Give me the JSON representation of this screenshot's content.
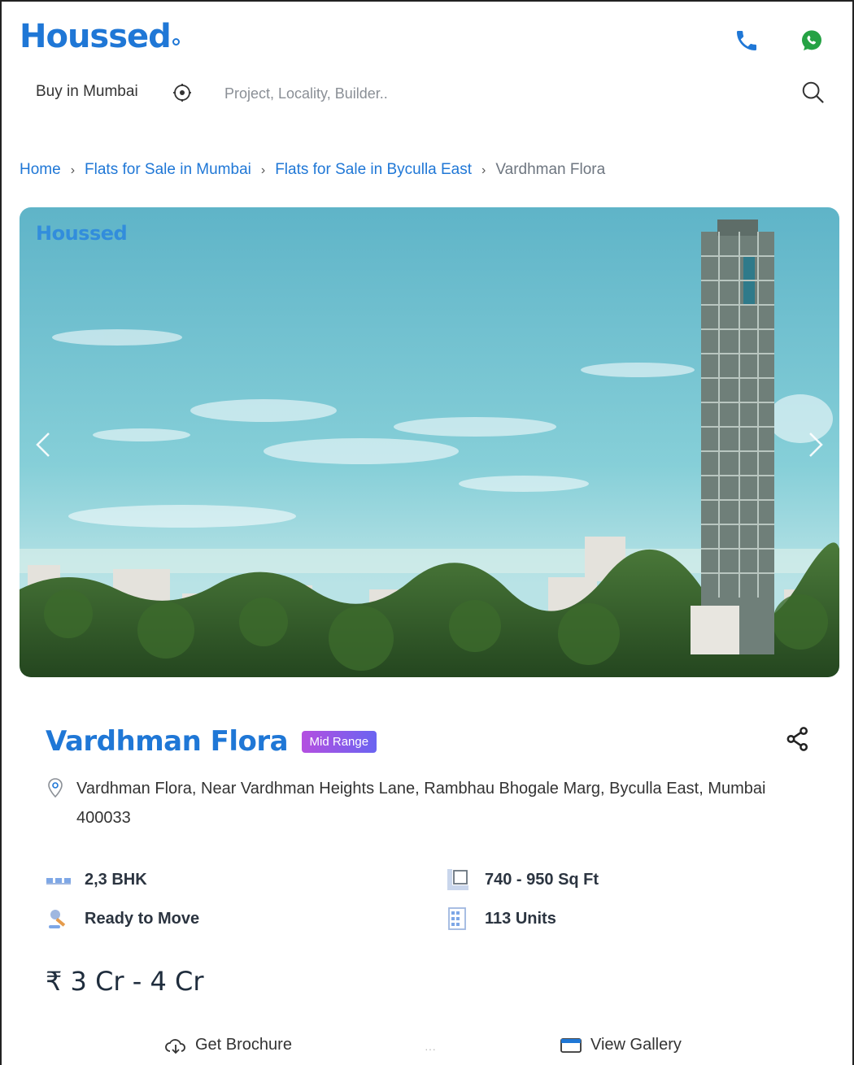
{
  "header": {
    "logo": "Houssed",
    "phone_icon": "phone-icon",
    "whatsapp_icon": "whatsapp-icon"
  },
  "search": {
    "city_label": "Buy in Mumbai",
    "placeholder": "Project, Locality, Builder.."
  },
  "breadcrumb": {
    "items": [
      "Home",
      "Flats for Sale in Mumbai",
      "Flats for Sale in Byculla East"
    ],
    "current": "Vardhman Flora"
  },
  "hero": {
    "watermark": "Houssed"
  },
  "project": {
    "title": "Vardhman Flora",
    "badge": "Mid Range",
    "address": "Vardhman Flora, Near Vardhman Heights Lane, Rambhau Bhogale Marg, Byculla East, Mumbai 400033",
    "features": {
      "bhk": "2,3 BHK",
      "status": "Ready to Move",
      "area": "740 - 950 Sq Ft",
      "units": "113 Units"
    },
    "price": "₹ 3 Cr - 4 Cr"
  },
  "actions": {
    "brochure": "Get Brochure",
    "gallery": "View Gallery"
  },
  "colors": {
    "brand": "#1f77d6",
    "badge_start": "#b44fe0",
    "badge_end": "#6a64f1",
    "whatsapp": "#25a244"
  }
}
